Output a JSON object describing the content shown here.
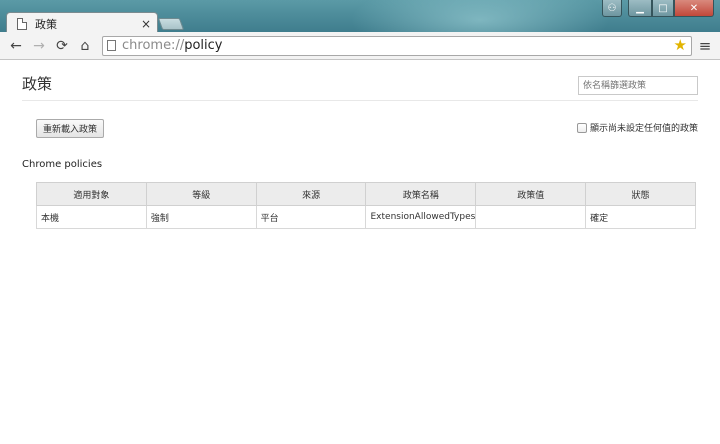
{
  "tab": {
    "title": "政策",
    "close": "×"
  },
  "window_controls": {
    "user": "⚇",
    "minimize": "▁",
    "maximize": "□",
    "close": "✕"
  },
  "toolbar": {
    "back": "←",
    "forward": "→",
    "reload": "⟳",
    "home": "⌂",
    "url_scheme": "chrome://",
    "url_path": "policy",
    "star": "★",
    "menu": "≡"
  },
  "page": {
    "title": "政策",
    "search_placeholder": "依名稱篩選政策",
    "reload_button": "重新載入政策",
    "show_unset_label": "顯示尚未設定任何值的政策",
    "section_heading": "Chrome policies"
  },
  "table": {
    "headers": [
      "適用對象",
      "等級",
      "來源",
      "政策名稱",
      "政策值",
      "狀態"
    ],
    "rows": [
      [
        "本機",
        "強制",
        "平台",
        "ExtensionAllowedTypes",
        "",
        "確定"
      ]
    ]
  },
  "colors": {
    "frame": "#4f8e9c",
    "star": "#e2b400",
    "close_button": "#c2483a"
  }
}
